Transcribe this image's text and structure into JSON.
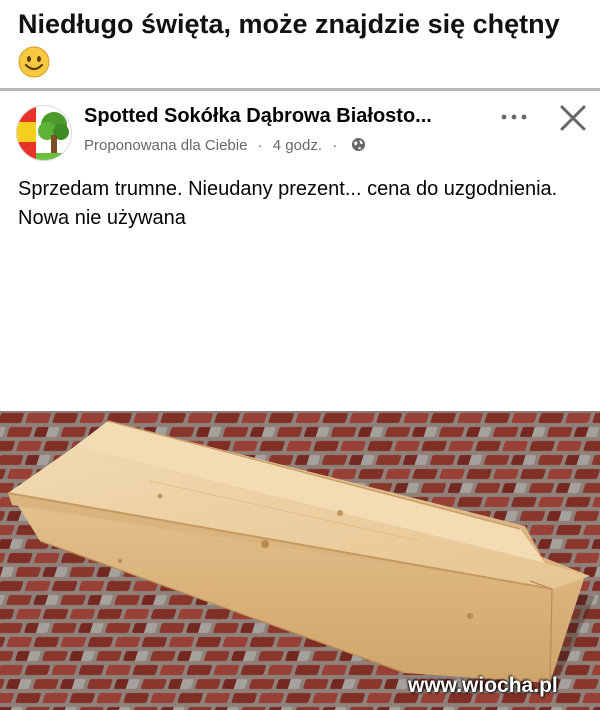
{
  "caption": {
    "text": "Niedługo święta, może znajdzie się chętny",
    "emoji_icon": "smiling-face-emoji"
  },
  "post": {
    "page_name": "Spotted Sokółka Dąbrowa Białosto...",
    "suggested_label": "Proponowana dla Ciebie",
    "separator": "·",
    "time": "4 godz.",
    "audience_icon": "globe-icon",
    "more_icon": "more-options-icon",
    "close_icon": "close-icon",
    "body": "Sprzedam trumne. Nieudany prezent... cena do uzgodnienia. Nowa nie używana",
    "photo_subject": "coffin-photo"
  },
  "watermark": "www.wiocha.pl"
}
